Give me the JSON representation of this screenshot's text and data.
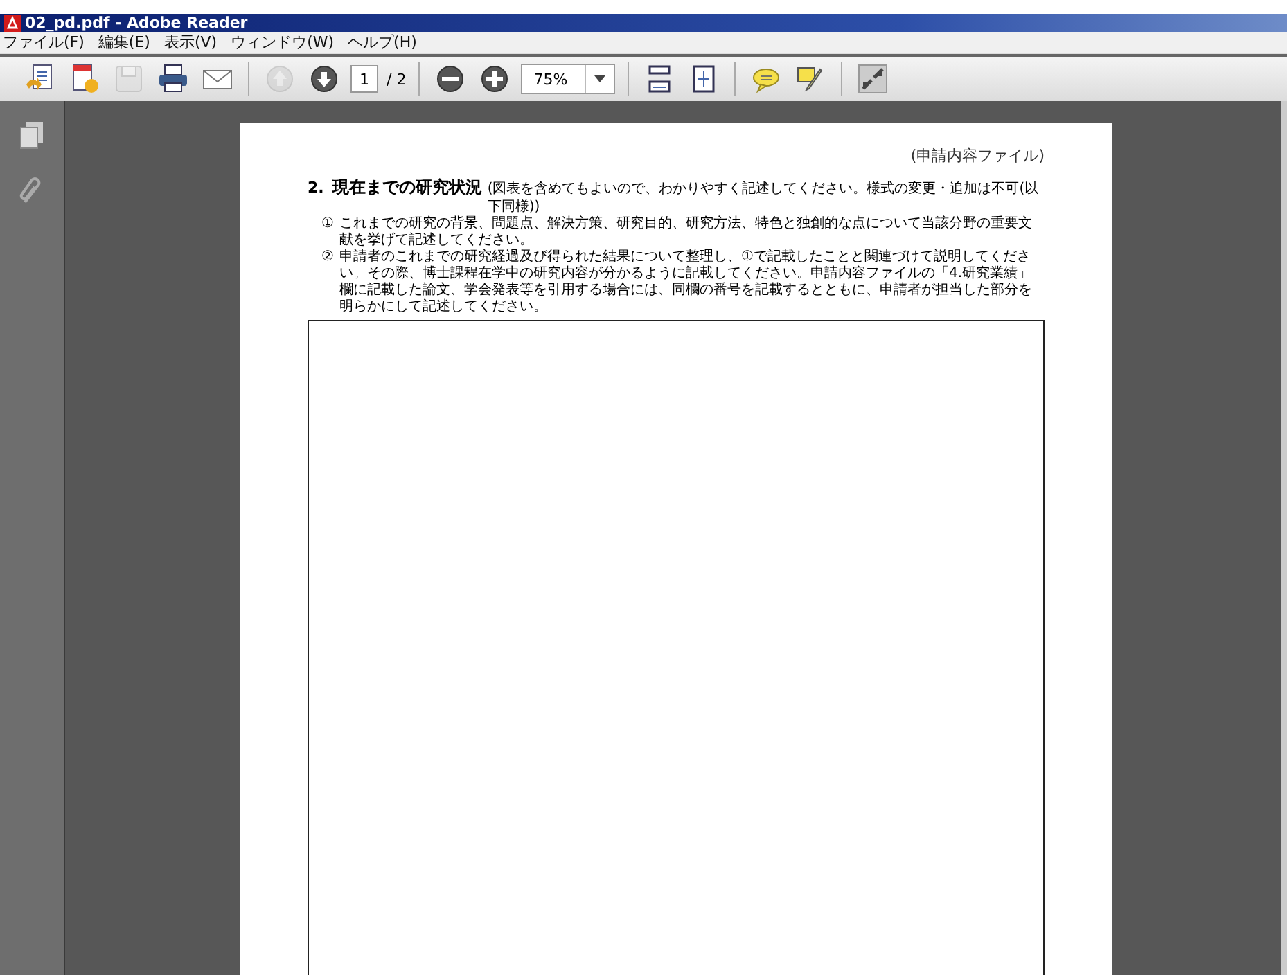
{
  "window": {
    "title": "02_pd.pdf - Adobe Reader"
  },
  "menu": [
    "ファイル(F)",
    "編集(E)",
    "表示(V)",
    "ウィンドウ(W)",
    "ヘルプ(H)"
  ],
  "toolbar": [
    {
      "kind": "create",
      "disabled": false
    },
    {
      "kind": "share",
      "disabled": false
    },
    {
      "kind": "save",
      "disabled": true
    },
    {
      "kind": "print",
      "disabled": false
    },
    {
      "kind": "email",
      "disabled": false
    },
    {
      "kind": "sep"
    },
    {
      "kind": "prev",
      "disabled": true
    },
    {
      "kind": "next",
      "disabled": false
    },
    {
      "kind": "page",
      "value": "1",
      "total": "/ 2"
    },
    {
      "kind": "sep"
    },
    {
      "kind": "zoomout",
      "disabled": false
    },
    {
      "kind": "zoomin",
      "disabled": false
    },
    {
      "kind": "zoom",
      "value": "75%"
    },
    {
      "kind": "sep"
    },
    {
      "kind": "fitwidth",
      "disabled": false
    },
    {
      "kind": "fitpage",
      "disabled": false
    },
    {
      "kind": "sep"
    },
    {
      "kind": "comment",
      "disabled": false
    },
    {
      "kind": "sign",
      "disabled": false
    },
    {
      "kind": "sep"
    },
    {
      "kind": "fullscreen",
      "disabled": false
    }
  ],
  "sidebar": [
    {
      "kind": "pages"
    },
    {
      "kind": "attachments"
    }
  ],
  "document": {
    "header": "(申請内容ファイル)",
    "number": "2.",
    "heading": "現在までの研究状況",
    "note": "(図表を含めてもよいので、わかりやすく記述してください。様式の変更・追加は不可(以下同様))",
    "items": [
      {
        "mark": "①",
        "text": "これまでの研究の背景、問題点、解決方策、研究目的、研究方法、特色と独創的な点について当該分野の重要文献を挙げて記述してください。"
      },
      {
        "mark": "②",
        "text": "申請者のこれまでの研究経過及び得られた結果について整理し、①で記載したことと関連づけて説明してください。その際、博士課程在学中の研究内容が分かるように記載してください。申請内容ファイルの「4.研究業績」欄に記載した論文、学会発表等を引用する場合には、同欄の番号を記載するとともに、申請者が担当した部分を明らかにして記述してください。"
      }
    ]
  }
}
